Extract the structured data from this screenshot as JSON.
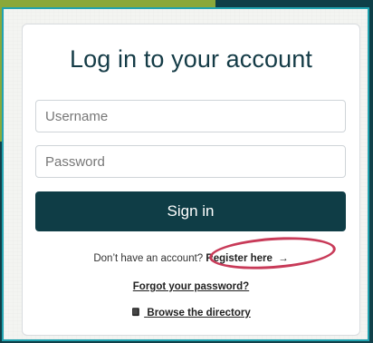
{
  "login": {
    "title": "Log in to your account",
    "username_placeholder": "Username",
    "password_placeholder": "Password",
    "signin_label": "Sign in",
    "register_prompt": "Don’t have an account?",
    "register_link": "Register here",
    "register_arrow": "→",
    "forgot_link": "Forgot your password?",
    "directory_link": "Browse the directory"
  },
  "icons": {
    "book": "book-icon"
  },
  "colors": {
    "background": "#0f3f48",
    "accent_green": "#8aa83a",
    "frame_border": "#21a3b0",
    "button": "#0f3d46",
    "title": "#143b46",
    "highlight": "#c83a58"
  }
}
